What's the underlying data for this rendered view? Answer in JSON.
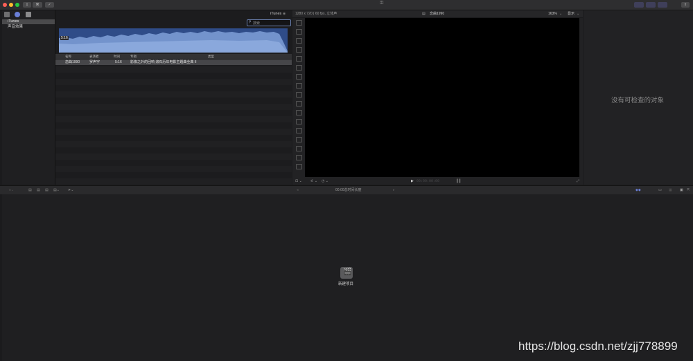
{
  "toolbar": {
    "import_icon": "download-icon",
    "keyword_label": "⌘",
    "check_icon": "checkmark-icon",
    "center_icon": "key-icon"
  },
  "sidebar": {
    "items": [
      {
        "label": "iTunes",
        "selected": true
      },
      {
        "label": "声音效果",
        "selected": false
      }
    ]
  },
  "browser": {
    "source_label": "iTunes",
    "search_placeholder": "搜索",
    "waveform_time": "5:16",
    "columns": [
      "名称",
      "表演者",
      "时间",
      "专辑",
      "类型"
    ],
    "rows": [
      {
        "name": "恋曲1990",
        "artist": "罗声宇",
        "time": "5:16",
        "album": "影像之外的回响 滚石历年电影主题曲全典 II",
        "kind": ""
      }
    ]
  },
  "viewer": {
    "format": "1280 x 720 | 60 fps, 立体声",
    "clip_title": "恋曲1990",
    "zoom": "163%",
    "view_label": "显示",
    "timecode": "00:00:00:00"
  },
  "inspector": {
    "empty_text": "没有可检查的对象"
  },
  "timeline": {
    "status": "00:00总时间长度",
    "new_project_label": "新建项目"
  },
  "watermark": "https://blog.csdn.net/zjj778899",
  "colors": {
    "accent": "#6a7fae",
    "waveform": "#2f4c88",
    "selected_row": "#464649"
  }
}
